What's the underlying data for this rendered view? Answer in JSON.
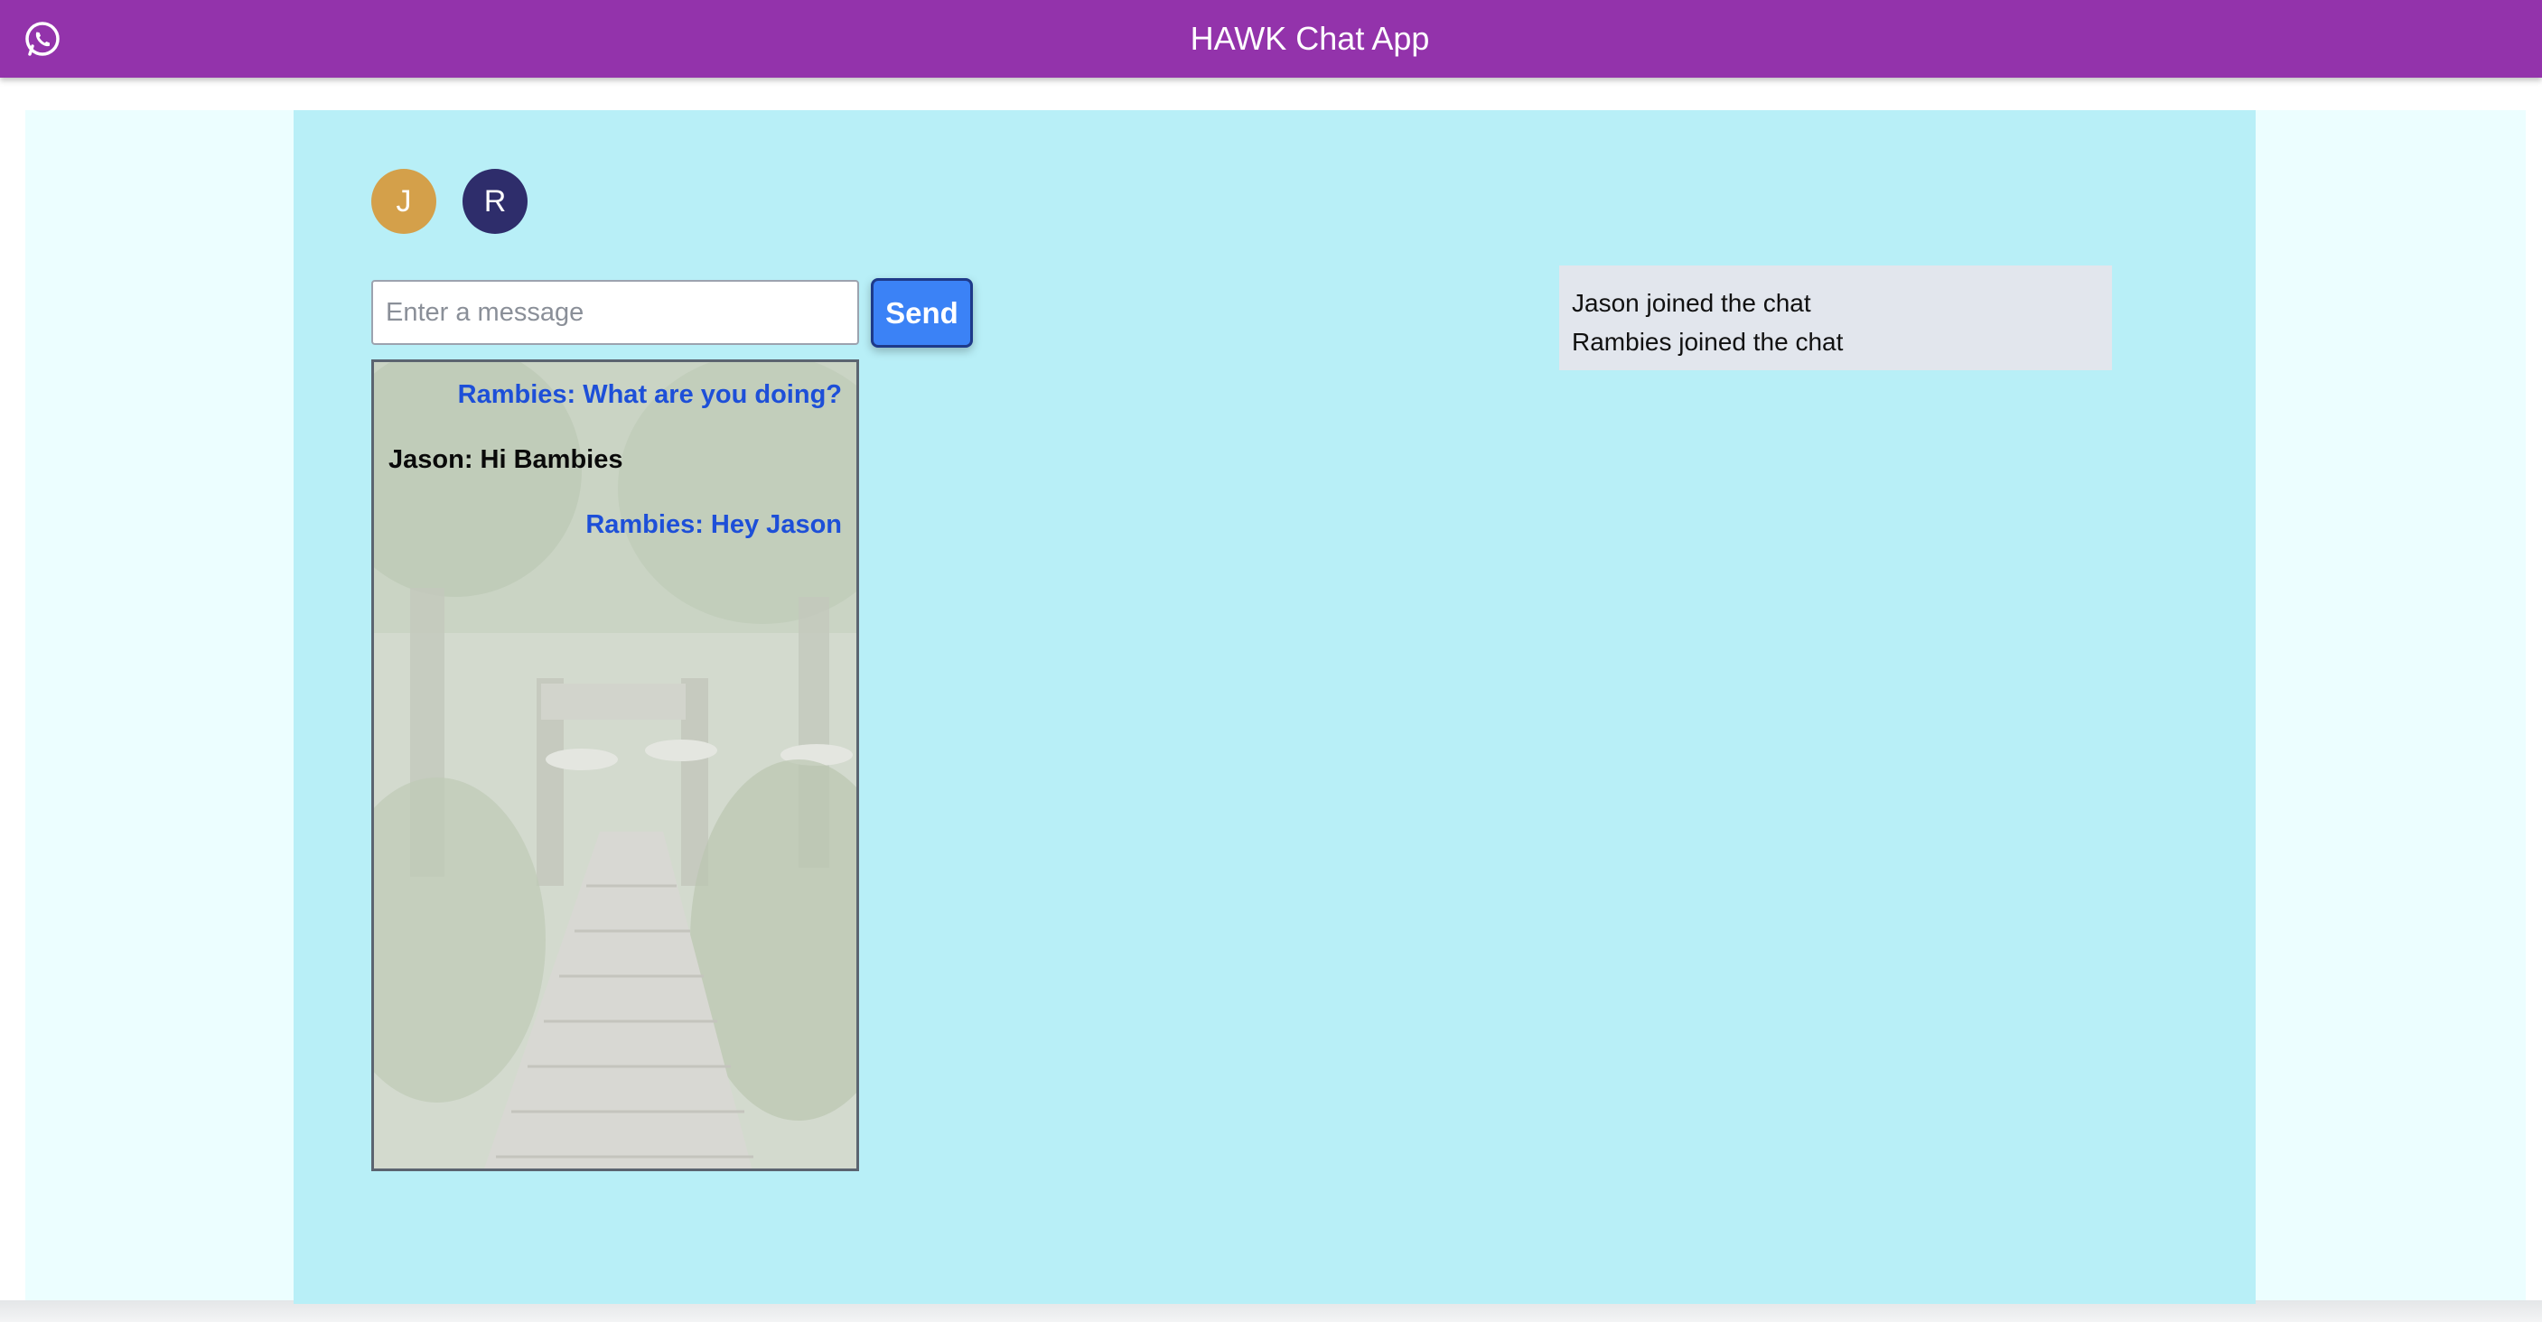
{
  "header": {
    "title": "HAWK Chat App",
    "logo_icon": "whatsapp-icon"
  },
  "users": [
    {
      "initial": "J",
      "color": "#d4a04a"
    },
    {
      "initial": "R",
      "color": "#2e2d6b"
    }
  ],
  "composer": {
    "placeholder": "Enter a message",
    "value": "",
    "send_label": "Send"
  },
  "messages": [
    {
      "text": "Rambies: What are you doing?",
      "align": "right"
    },
    {
      "text": "Jason: Hi Bambies",
      "align": "left"
    },
    {
      "text": "Rambies: Hey Jason",
      "align": "right"
    }
  ],
  "notifications": [
    "Jason joined the chat",
    "Rambies joined the chat"
  ],
  "colors": {
    "header": "#9333ab",
    "panel": "#b8eff7",
    "send_button": "#3b82f6",
    "own_message": "#1d4fd8"
  }
}
